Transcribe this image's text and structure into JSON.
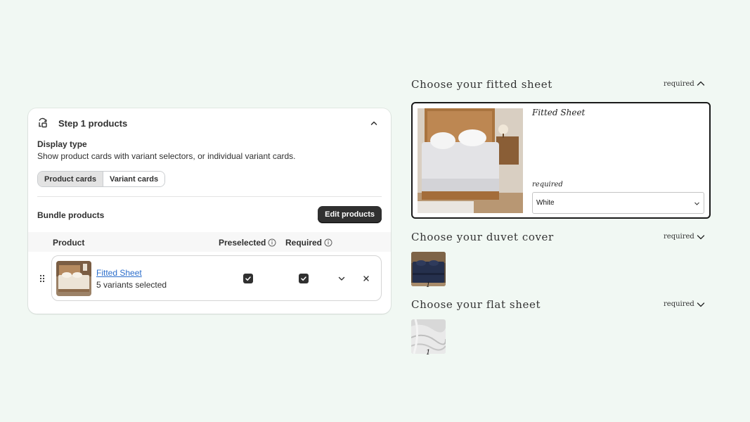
{
  "admin": {
    "step_title": "Step 1 products",
    "display_type_label": "Display type",
    "display_type_desc": "Show product cards with variant selectors, or individual variant cards.",
    "segments": [
      "Product cards",
      "Variant cards"
    ],
    "selected_segment": "Product cards",
    "bundle_label": "Bundle products",
    "edit_button": "Edit products",
    "columns": {
      "product": "Product",
      "preselected": "Preselected",
      "required": "Required"
    },
    "rows": [
      {
        "title": "Fitted Sheet",
        "subtitle": "5 variants selected",
        "preselected": true,
        "required": true
      }
    ]
  },
  "preview": {
    "sections": [
      {
        "title": "Choose your fitted sheet",
        "required_label": "required",
        "expanded": true
      },
      {
        "title": "Choose your duvet cover",
        "required_label": "required",
        "expanded": false,
        "qty": "1"
      },
      {
        "title": "Choose your flat sheet",
        "required_label": "required",
        "expanded": false,
        "qty": "1"
      }
    ],
    "fitted": {
      "product_name": "Fitted Sheet",
      "required_label": "required",
      "selected_variant": "White"
    }
  },
  "colors": {
    "background": "#f1f8f3",
    "primary_button": "#303030",
    "link": "#2c6ecb"
  }
}
